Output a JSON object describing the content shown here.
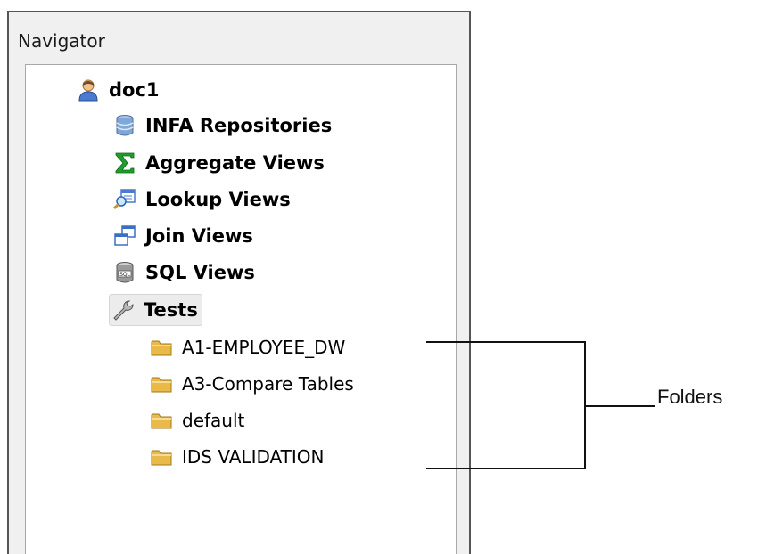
{
  "navigator": {
    "title": "Navigator",
    "root": {
      "label": "doc1",
      "icon": "user-icon"
    },
    "items": [
      {
        "label": "INFA Repositories",
        "icon": "database-icon"
      },
      {
        "label": "Aggregate Views",
        "icon": "sigma-icon"
      },
      {
        "label": "Lookup Views",
        "icon": "lookup-icon"
      },
      {
        "label": "Join Views",
        "icon": "join-icon"
      },
      {
        "label": "SQL Views",
        "icon": "sql-icon"
      },
      {
        "label": "Tests",
        "icon": "wrench-icon",
        "selected": true
      }
    ],
    "folders": [
      {
        "label": "A1-EMPLOYEE_DW",
        "icon": "folder-icon"
      },
      {
        "label": "A3-Compare Tables",
        "icon": "folder-icon"
      },
      {
        "label": "default",
        "icon": "folder-icon"
      },
      {
        "label": "IDS VALIDATION",
        "icon": "folder-icon"
      }
    ]
  },
  "annotation": {
    "label": "Folders"
  },
  "colors": {
    "folder": "#e9b949",
    "sigma": "#1f9e2c",
    "user": "#4a7bd0",
    "database": "#7fa7d8"
  }
}
